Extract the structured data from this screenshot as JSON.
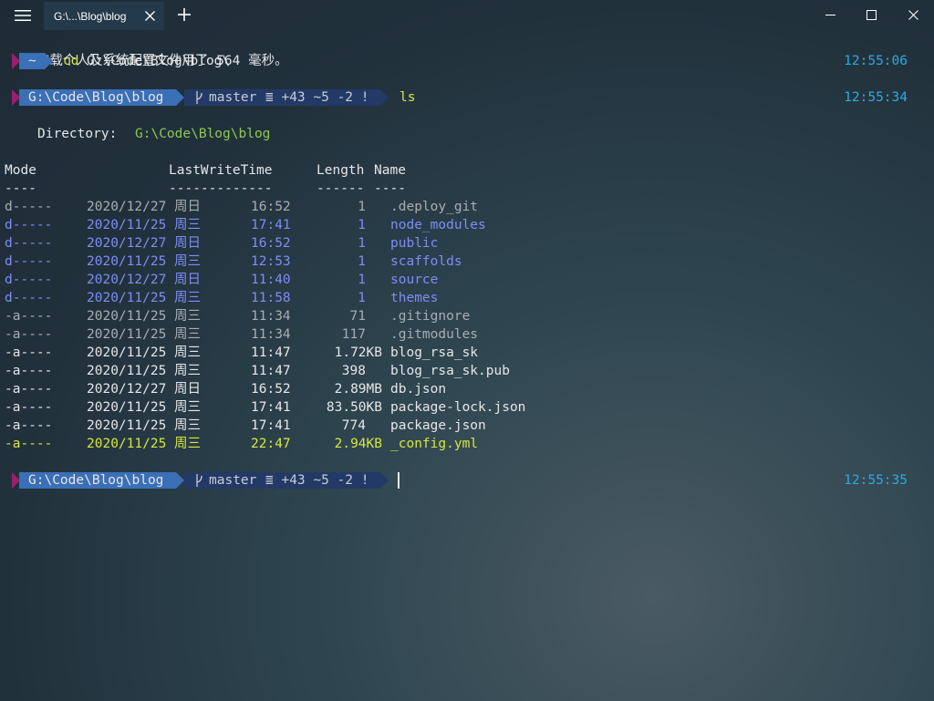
{
  "window": {
    "tab_title": "G:\\...\\Blog\\blog",
    "menu_icon": "hamburger-menu-icon",
    "new_tab_icon": "plus-icon",
    "controls": [
      "minimize-icon",
      "maximize-icon",
      "close-icon"
    ]
  },
  "colors": {
    "background": "#22333d",
    "timestamp": "#2fa9dd",
    "command": "#d8e44c",
    "directory_entry": "#7f8cf5",
    "hidden_entry": "#a9adb1",
    "highlight_entry": "#d7e63c",
    "prompt_path_bg": "#3b6fb6",
    "prompt_git_bg": "#233a66",
    "prompt_accent": "#9c1f6e"
  },
  "terminal": {
    "profile_message": "加载个人及系统配置文件用了 564 毫秒。",
    "prompt1": {
      "path": "~",
      "command": "cd",
      "argument": "G:\\Code\\Blog\\blog\\",
      "time": "12:55:06"
    },
    "prompt2": {
      "path": "G:\\Code\\Blog\\blog",
      "branch": "master",
      "status": "≣ +43 ~5 -2 !",
      "command": "ls",
      "time": "12:55:34"
    },
    "directory_label": "Directory:",
    "directory_path": "G:\\Code\\Blog\\blog",
    "headers": {
      "mode": "Mode",
      "time": "LastWriteTime",
      "length": "Length",
      "name": "Name",
      "mode_rule": "----",
      "time_rule": "-------------",
      "length_rule": "------",
      "name_rule": "----"
    },
    "entries": [
      {
        "mode": "d-----",
        "date": "2020/12/27 周日",
        "time": "16:52",
        "length": "1",
        "name": ".deploy_git",
        "style": "gray"
      },
      {
        "mode": "d-----",
        "date": "2020/11/25 周三",
        "time": "17:41",
        "length": "1",
        "name": "node_modules",
        "style": "blue"
      },
      {
        "mode": "d-----",
        "date": "2020/12/27 周日",
        "time": "16:52",
        "length": "1",
        "name": "public",
        "style": "blue"
      },
      {
        "mode": "d-----",
        "date": "2020/11/25 周三",
        "time": "12:53",
        "length": "1",
        "name": "scaffolds",
        "style": "blue"
      },
      {
        "mode": "d-----",
        "date": "2020/12/27 周日",
        "time": "11:40",
        "length": "1",
        "name": "source",
        "style": "blue"
      },
      {
        "mode": "d-----",
        "date": "2020/11/25 周三",
        "time": "11:58",
        "length": "1",
        "name": "themes",
        "style": "blue"
      },
      {
        "mode": "-a----",
        "date": "2020/11/25 周三",
        "time": "11:34",
        "length": "71",
        "name": ".gitignore",
        "style": "gray"
      },
      {
        "mode": "-a----",
        "date": "2020/11/25 周三",
        "time": "11:34",
        "length": "117",
        "name": ".gitmodules",
        "style": "gray"
      },
      {
        "mode": "-a----",
        "date": "2020/11/25 周三",
        "time": "11:47",
        "length": "1.72KB",
        "name": "blog_rsa_sk",
        "style": "white"
      },
      {
        "mode": "-a----",
        "date": "2020/11/25 周三",
        "time": "11:47",
        "length": "398",
        "name": "blog_rsa_sk.pub",
        "style": "white"
      },
      {
        "mode": "-a----",
        "date": "2020/12/27 周日",
        "time": "16:52",
        "length": "2.89MB",
        "name": "db.json",
        "style": "white"
      },
      {
        "mode": "-a----",
        "date": "2020/11/25 周三",
        "time": "17:41",
        "length": "83.50KB",
        "name": "package-lock.json",
        "style": "white"
      },
      {
        "mode": "-a----",
        "date": "2020/11/25 周三",
        "time": "17:41",
        "length": "774",
        "name": "package.json",
        "style": "white"
      },
      {
        "mode": "-a----",
        "date": "2020/11/25 周三",
        "time": "22:47",
        "length": "2.94KB",
        "name": "_config.yml",
        "style": "yellow"
      }
    ],
    "prompt3": {
      "path": "G:\\Code\\Blog\\blog",
      "branch": "master",
      "status": "≣ +43 ~5 -2 !",
      "time": "12:55:35"
    }
  }
}
